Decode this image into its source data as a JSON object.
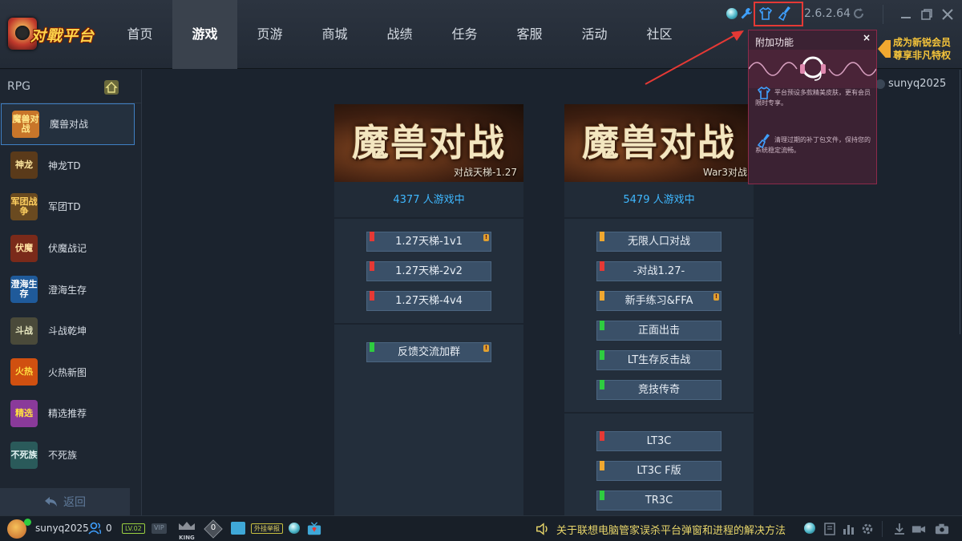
{
  "app": {
    "logo_text": "对戰平台",
    "version": "2.6.2.64"
  },
  "nav": {
    "items": [
      {
        "label": "首页"
      },
      {
        "label": "游戏"
      },
      {
        "label": "页游"
      },
      {
        "label": "商城"
      },
      {
        "label": "战绩"
      },
      {
        "label": "任务"
      },
      {
        "label": "客服"
      },
      {
        "label": "活动"
      },
      {
        "label": "社区"
      }
    ],
    "active": "游戏"
  },
  "sidebar": {
    "category": "RPG",
    "back_label": "返回",
    "items": [
      {
        "label": "魔兽对战",
        "thumb_text": "魔兽对战",
        "color": "#c8762a"
      },
      {
        "label": "神龙TD",
        "thumb_text": "神龙",
        "color": "#5a3a1a"
      },
      {
        "label": "军团TD",
        "thumb_text": "军团战争",
        "color": "#6a4a20"
      },
      {
        "label": "伏魔战记",
        "thumb_text": "伏魔",
        "color": "#7a2a1a"
      },
      {
        "label": "澄海生存",
        "thumb_text": "澄海生存",
        "color": "#1f5a9a"
      },
      {
        "label": "斗战乾坤",
        "thumb_text": "斗战",
        "color": "#4a4a3a"
      },
      {
        "label": "火热新图",
        "thumb_text": "火热",
        "color": "#d05010"
      },
      {
        "label": "精选推荐",
        "thumb_text": "精选",
        "color": "#8a3a9a"
      },
      {
        "label": "不死族",
        "thumb_text": "不死族",
        "color": "#2a5a5a"
      }
    ]
  },
  "cards": [
    {
      "banner_title": "魔兽对战",
      "banner_sub": "对战天梯-1.27",
      "players": "4377 人游戏中",
      "rooms_a": [
        {
          "label": "1.27天梯-1v1",
          "flag": "#e53935",
          "warn": true
        },
        {
          "label": "1.27天梯-2v2",
          "flag": "#e53935",
          "warn": false
        },
        {
          "label": "1.27天梯-4v4",
          "flag": "#e53935",
          "warn": false
        }
      ],
      "rooms_b": [
        {
          "label": "反馈交流加群",
          "flag": "#2ecc40",
          "warn": true
        }
      ]
    },
    {
      "banner_title": "魔兽对战",
      "banner_sub": "War3对战",
      "players": "5479 人游戏中",
      "rooms_a": [
        {
          "label": "无限人口对战",
          "flag": "#f0a830",
          "warn": false
        },
        {
          "label": "-对战1.27-",
          "flag": "#e53935",
          "warn": false
        },
        {
          "label": "新手练习&FFA",
          "flag": "#f0a830",
          "warn": true
        },
        {
          "label": "正面出击",
          "flag": "#2ecc40",
          "warn": false
        },
        {
          "label": "LT生存反击战",
          "flag": "#2ecc40",
          "warn": false
        },
        {
          "label": "竞技传奇",
          "flag": "#2ecc40",
          "warn": false
        }
      ],
      "rooms_b": [
        {
          "label": "LT3C",
          "flag": "#e53935",
          "warn": false
        },
        {
          "label": "LT3C F版",
          "flag": "#f0a830",
          "warn": false
        },
        {
          "label": "TR3C",
          "flag": "#2ecc40",
          "warn": false
        }
      ]
    }
  ],
  "popup": {
    "title": "附加功能",
    "close": "×",
    "row1": "平台预设多款精美皮肤，更有会员限时专享。",
    "row2": "清理过期的补丁包文件，保持您的系统稳定流畅。"
  },
  "vip_banner": {
    "line1": "成为新锐会员",
    "line2": "尊享非凡特权"
  },
  "username_right": "sunyq2025",
  "bottombar": {
    "username": "sunyq2025",
    "friends_count": "0",
    "level_badge": "LV.02",
    "vip_badge": "VIP",
    "king_label": "KING",
    "diamond_count": "0",
    "plugin_badge": "外挂举报",
    "notice": "关于联想电脑管家误杀平台弹窗和进程的解决方法"
  }
}
